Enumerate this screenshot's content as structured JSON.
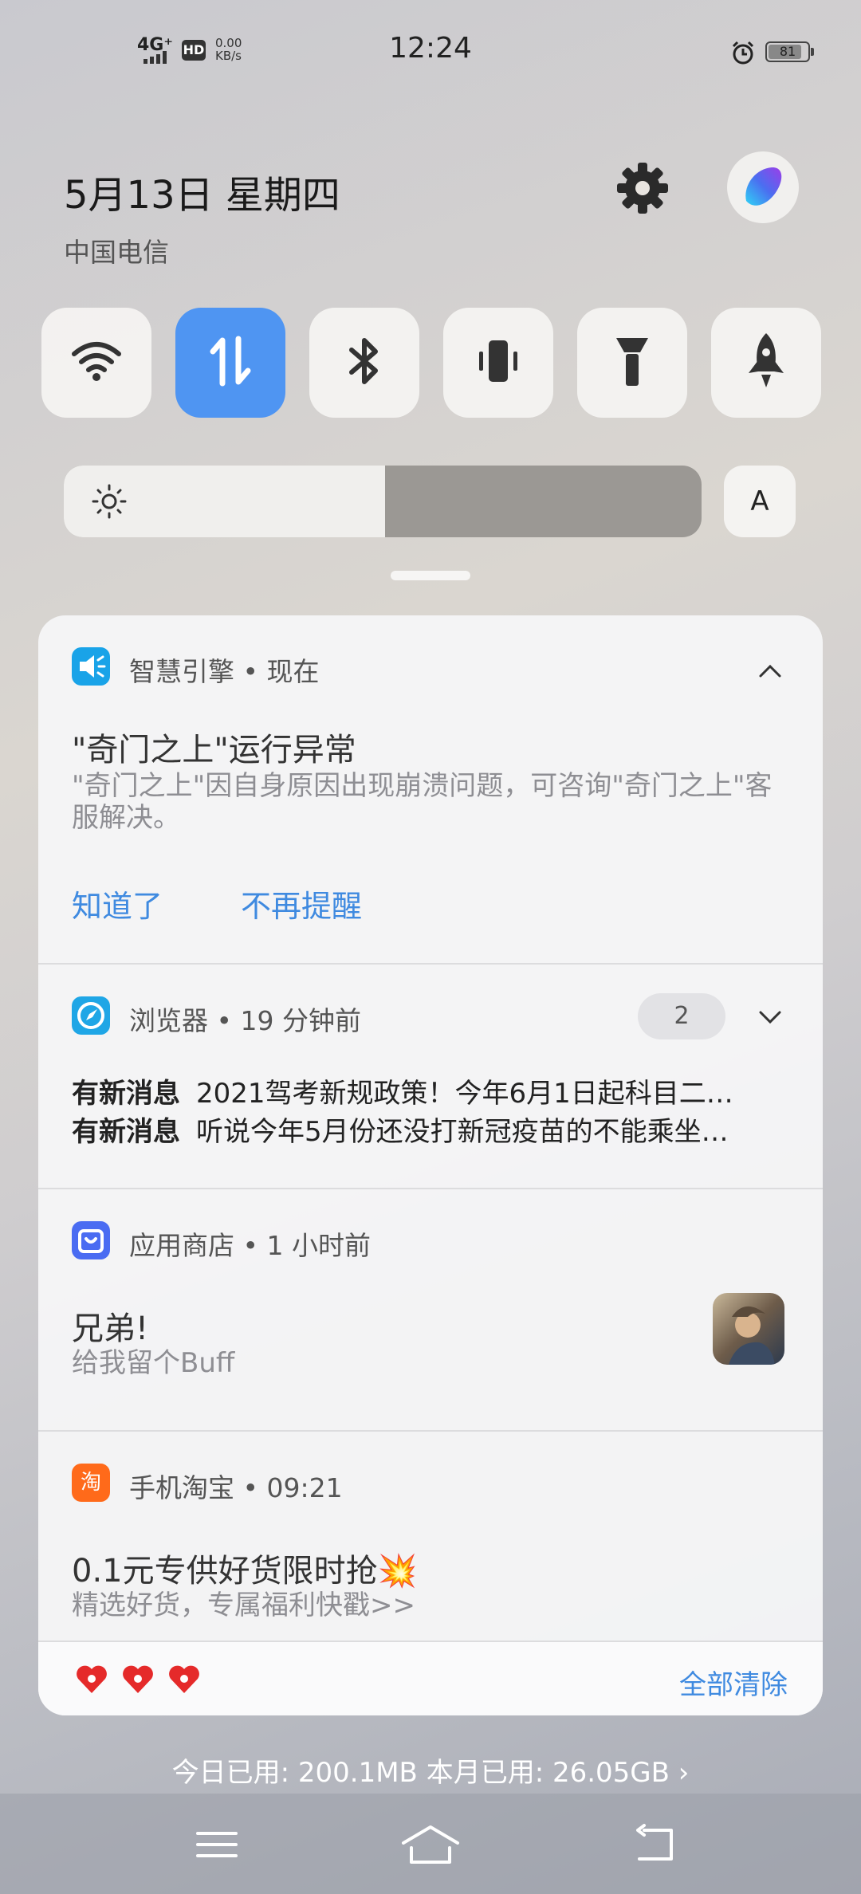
{
  "status_bar": {
    "network": "4G⁺",
    "hd": "HD",
    "speed_value": "0.00",
    "speed_unit": "KB/s",
    "time": "12:24",
    "battery": "81"
  },
  "header": {
    "date": "5月13日 星期四",
    "carrier": "中国电信"
  },
  "quick_toggles": [
    {
      "name": "wifi",
      "active": false
    },
    {
      "name": "mobile-data",
      "active": true
    },
    {
      "name": "bluetooth",
      "active": false
    },
    {
      "name": "vibrate",
      "active": false
    },
    {
      "name": "flashlight",
      "active": false
    },
    {
      "name": "airplane-rocket",
      "active": false
    }
  ],
  "brightness": {
    "level": 0.5,
    "auto_label": "A"
  },
  "notifications": [
    {
      "app": "智慧引擎",
      "time": "现在",
      "title": "\"奇门之上\"运行异常",
      "text": "\"奇门之上\"因自身原因出现崩溃问题，可咨询\"奇门之上\"客服解决。",
      "actions": [
        "知道了",
        "不再提醒"
      ]
    },
    {
      "app": "浏览器",
      "time": "19 分钟前",
      "count": "2",
      "messages": [
        {
          "tag": "有新消息",
          "text": "2021驾考新规政策！今年6月1日起科目二…"
        },
        {
          "tag": "有新消息",
          "text": "听说今年5月份还没打新冠疫苗的不能乘坐…"
        }
      ]
    },
    {
      "app": "应用商店",
      "time": "1 小时前",
      "title": "兄弟!",
      "text": "给我留个Buff"
    },
    {
      "app": "手机淘宝",
      "time": "09:21",
      "title": "0.1元专供好货限时抢💥",
      "text": "精选好货，专属福利快戳>>"
    }
  ],
  "footer": {
    "clear_all": "全部清除"
  },
  "usage": "今日已用: 200.1MB 本月已用: 26.05GB ›",
  "colors": {
    "accent": "#3f8ae0",
    "toggle_on": "#4f95f2"
  }
}
